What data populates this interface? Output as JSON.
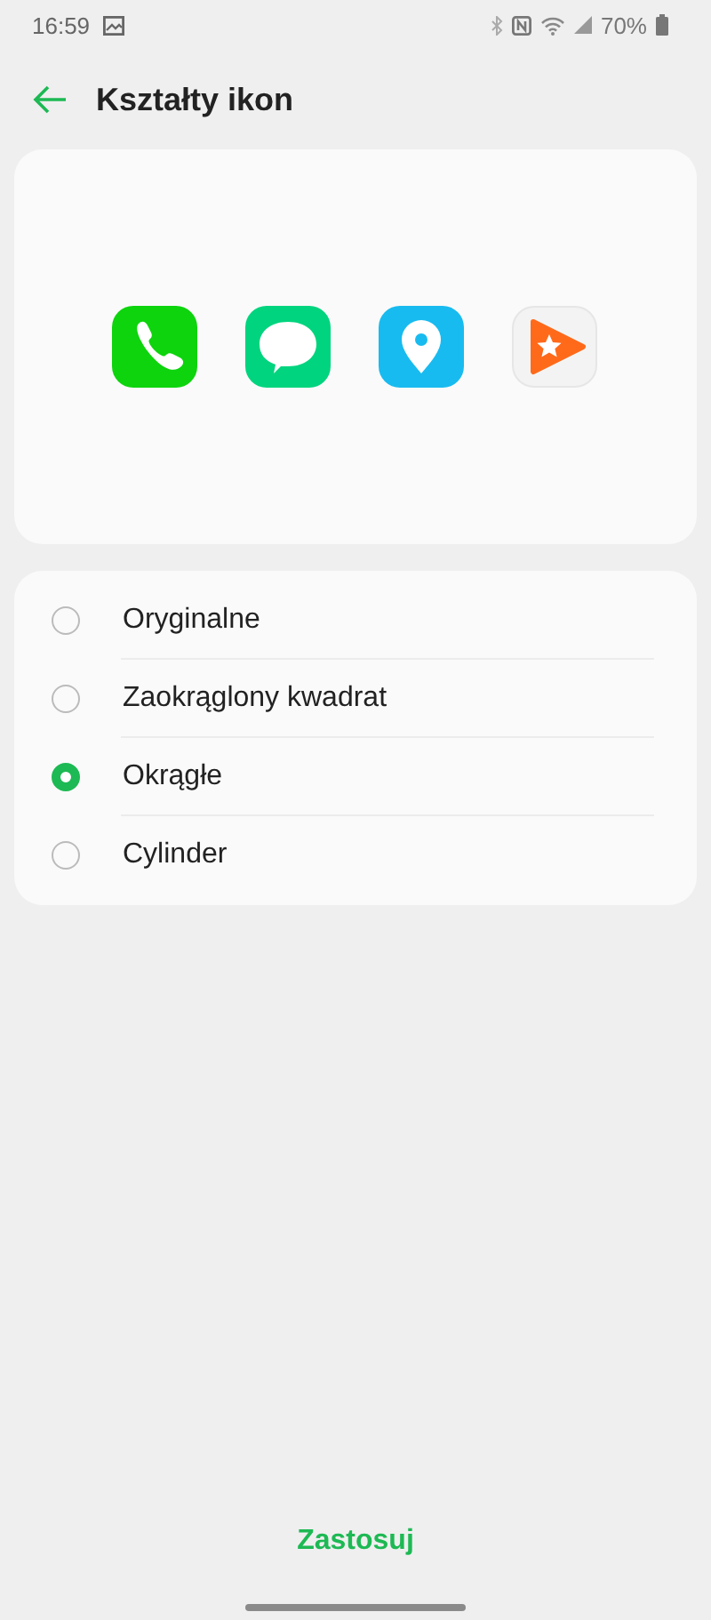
{
  "status_bar": {
    "time": "16:59",
    "battery": "70%"
  },
  "header": {
    "title": "Kształty ikon"
  },
  "options": [
    {
      "label": "Oryginalne",
      "selected": false
    },
    {
      "label": "Zaokrąglony kwadrat",
      "selected": false
    },
    {
      "label": "Okrągłe",
      "selected": true
    },
    {
      "label": "Cylinder",
      "selected": false
    }
  ],
  "apply_button": "Zastosuj"
}
